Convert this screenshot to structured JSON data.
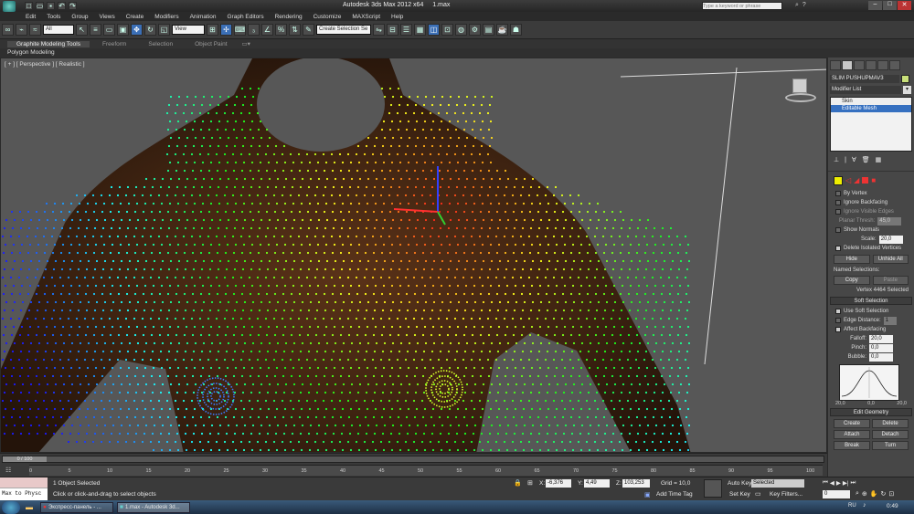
{
  "app": {
    "title": "Autodesk 3ds Max  2012 x64",
    "file": "1.max",
    "search_placeholder": "Type a keyword or phrase"
  },
  "menu": [
    "Edit",
    "Tools",
    "Group",
    "Views",
    "Create",
    "Modifiers",
    "Animation",
    "Graph Editors",
    "Rendering",
    "Customize",
    "MAXScript",
    "Help"
  ],
  "toolbar": {
    "filter_value": "All",
    "refcoord_value": "View",
    "named_selection_placeholder": "Create Selection Se"
  },
  "ribbon": {
    "tabs": [
      "Graphite Modeling Tools",
      "Freeform",
      "Selection",
      "Object Paint"
    ],
    "active_panel": "Polygon Modeling"
  },
  "viewport": {
    "label": "[ + ] [ Perspective ] [ Realistic ]"
  },
  "command_panel": {
    "object_name": "SLIM PUSHUPMAV3",
    "object_color": "#c9e07a",
    "modifier_list": "Modifier List",
    "stack": [
      "Skin",
      "Editable Mesh"
    ],
    "selection": {
      "by_vertex": "By Vertex",
      "ignore_backfacing": "Ignore Backfacing",
      "ignore_visible_edges": "Ignore Visible Edges",
      "planar_thresh_label": "Planar Thresh:",
      "planar_thresh_value": "45,0",
      "show_normals": "Show Normals",
      "scale_label": "Scale:",
      "scale_value": "20,0",
      "delete_isolated": "Delete Isolated Vertices",
      "hide": "Hide",
      "unhide_all": "Unhide All",
      "named_selections": "Named Selections:",
      "copy": "Copy",
      "paste": "Paste",
      "status": "Vertex 4464 Selected"
    },
    "soft_selection": {
      "title": "Soft Selection",
      "use_soft": "Use Soft Selection",
      "edge_distance": "Edge Distance:",
      "edge_distance_value": "1",
      "affect_backfacing": "Affect Backfacing",
      "falloff_label": "Falloff:",
      "falloff_value": "20,0",
      "pinch_label": "Pinch:",
      "pinch_value": "0,0",
      "bubble_label": "Bubble:",
      "bubble_value": "0,0",
      "curve_left": "20,0",
      "curve_mid": "0,0",
      "curve_right": "20,0"
    },
    "edit_geometry": {
      "title": "Edit Geometry",
      "buttons": [
        "Create",
        "Delete",
        "Attach",
        "Detach",
        "Break",
        "Turn"
      ]
    }
  },
  "timeline": {
    "frame": "0 / 100",
    "ticks": [
      "0",
      "5",
      "10",
      "15",
      "20",
      "25",
      "30",
      "35",
      "40",
      "45",
      "50",
      "55",
      "60",
      "65",
      "70",
      "75",
      "80",
      "85",
      "90",
      "95",
      "100"
    ]
  },
  "status": {
    "maxscript": "Max to Physc",
    "selected": "1 Object Selected",
    "prompt": "Click or click-and-drag to select objects",
    "x_label": "X:",
    "x_value": "-6,376",
    "y_label": "Y:",
    "y_value": "4,49",
    "z_label": "Z:",
    "z_value": "103,253",
    "grid": "Grid = 10,0",
    "add_time_tag": "Add Time Tag",
    "auto_key": "Auto Key",
    "key_mode": "Selected",
    "set_key": "Set Key",
    "key_filters": "Key Filters...",
    "frame_value": "0"
  },
  "taskbar": {
    "items": [
      "Экспресс-панель - ...",
      "1.max - Autodesk 3d..."
    ],
    "lang": "RU",
    "time": "0:49"
  }
}
